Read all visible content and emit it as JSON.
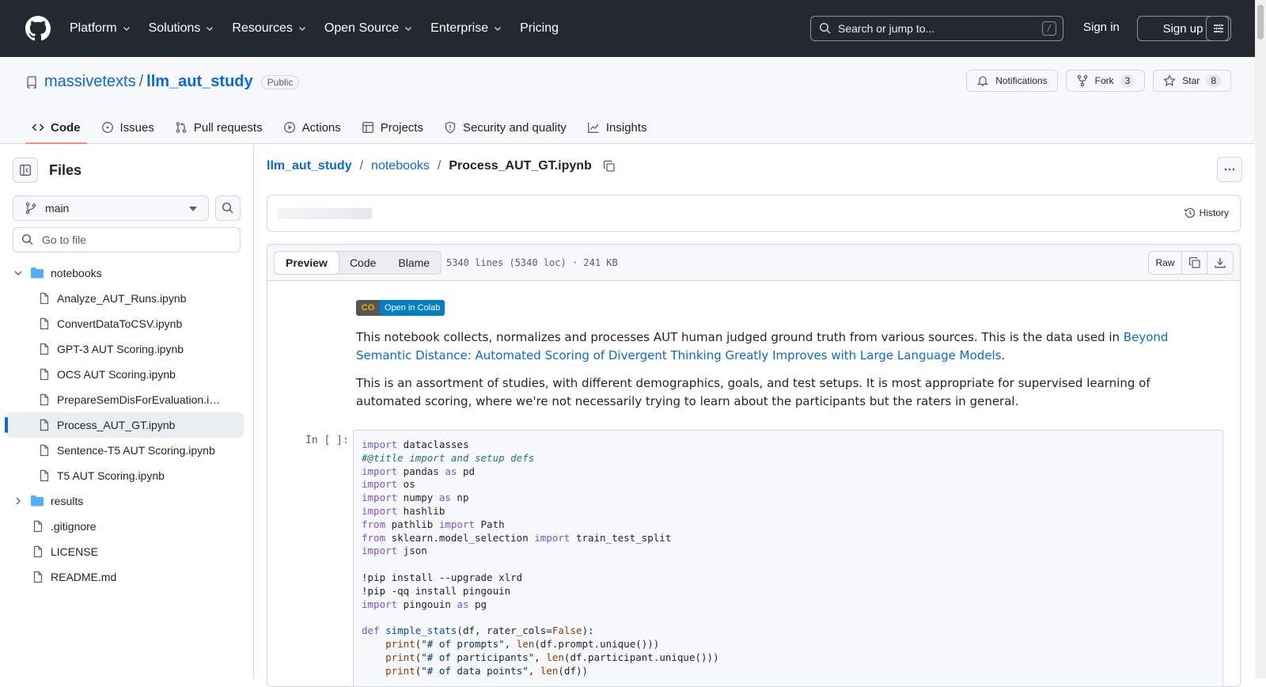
{
  "topnav": {
    "items": [
      "Platform",
      "Solutions",
      "Resources",
      "Open Source",
      "Enterprise",
      "Pricing"
    ],
    "search_placeholder": "Search or jump to...",
    "search_shortcut": "/",
    "sign_in": "Sign in",
    "sign_up": "Sign up"
  },
  "repo": {
    "owner": "massivetexts",
    "separator": "/",
    "name": "llm_aut_study",
    "visibility": "Public",
    "notifications": "Notifications",
    "fork_label": "Fork",
    "fork_count": "3",
    "star_label": "Star",
    "star_count": "8",
    "tabs": [
      "Code",
      "Issues",
      "Pull requests",
      "Actions",
      "Projects",
      "Security and quality",
      "Insights"
    ]
  },
  "sidebar": {
    "title": "Files",
    "branch": "main",
    "goto_placeholder": "Go to file",
    "tree": [
      {
        "label": "notebooks",
        "type": "folder",
        "open": true,
        "depth": 0
      },
      {
        "label": "Analyze_AUT_Runs.ipynb",
        "type": "file",
        "depth": 1
      },
      {
        "label": "ConvertDataToCSV.ipynb",
        "type": "file",
        "depth": 1
      },
      {
        "label": "GPT-3 AUT Scoring.ipynb",
        "type": "file",
        "depth": 1
      },
      {
        "label": "OCS AUT Scoring.ipynb",
        "type": "file",
        "depth": 1
      },
      {
        "label": "PrepareSemDisForEvaluation.i…",
        "type": "file",
        "depth": 1
      },
      {
        "label": "Process_AUT_GT.ipynb",
        "type": "file",
        "depth": 1,
        "selected": true
      },
      {
        "label": "Sentence-T5 AUT Scoring.ipynb",
        "type": "file",
        "depth": 1
      },
      {
        "label": "T5 AUT Scoring.ipynb",
        "type": "file",
        "depth": 1
      },
      {
        "label": "results",
        "type": "folder",
        "open": false,
        "depth": 0
      },
      {
        "label": ".gitignore",
        "type": "file",
        "depth": 0
      },
      {
        "label": "LICENSE",
        "type": "file",
        "depth": 0
      },
      {
        "label": "README.md",
        "type": "file",
        "depth": 0
      }
    ]
  },
  "breadcrumb": {
    "root": "llm_aut_study",
    "folder": "notebooks",
    "file": "Process_AUT_GT.ipynb",
    "separator": "/"
  },
  "history": "History",
  "viewer": {
    "modes": [
      "Preview",
      "Code",
      "Blame"
    ],
    "info": "5340 lines (5340 loc) · 241 KB",
    "raw": "Raw"
  },
  "notebook": {
    "badge_left": "CO",
    "badge_right": "Open in Colab",
    "para1_a": "This notebook collects, normalizes and processes AUT human judged ground truth from various sources. This is the data used in ",
    "para1_link": "Beyond Semantic Distance: Automated Scoring of Divergent Thinking Greatly Improves with Large Language Models",
    "para1_b": ".",
    "para2": "This is an assortment of studies, with different demographics, goals, and test setups. It is most appropriate for supervised learning of automated scoring, where we're not necessarily trying to learn about the participants but the raters in general.",
    "prompt": "In [ ]:"
  },
  "colors": {
    "topbar": "#24292f",
    "link": "#0969da",
    "active_tab": "#fd8c73",
    "folder": "#54aeff"
  }
}
